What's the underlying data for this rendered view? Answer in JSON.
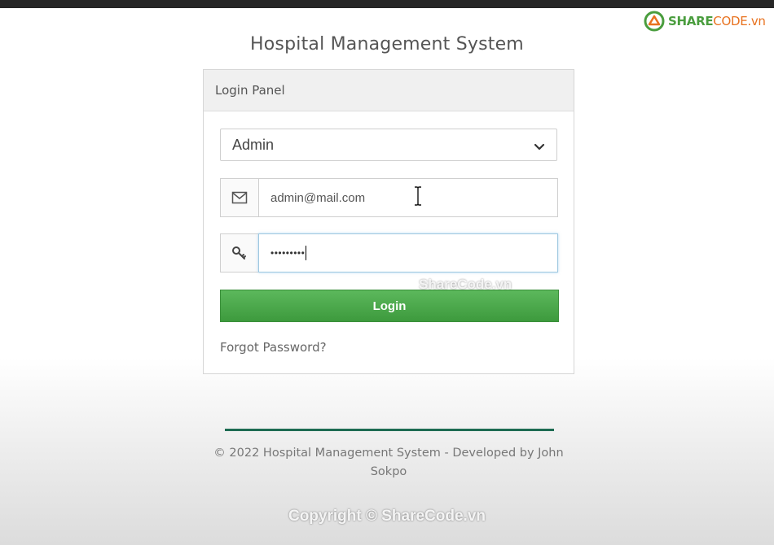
{
  "brand": {
    "part1": "SHARE",
    "part2": "CODE.vn",
    "icon": "sharecode-logo-icon"
  },
  "page": {
    "title": "Hospital Management System"
  },
  "login_panel": {
    "heading": "Login Panel",
    "role_select": {
      "value": "Admin",
      "icon": "chevron-down-icon"
    },
    "email": {
      "value": "admin@mail.com",
      "icon": "envelope-icon"
    },
    "password": {
      "masked_value": "•••••••••",
      "icon": "key-icon"
    },
    "login_button": "Login",
    "forgot_link": "Forgot Password?"
  },
  "footer": {
    "text": "© 2022 Hospital Management System - Developed by John Sokpo"
  },
  "watermarks": {
    "middle": "ShareCode.vn",
    "bottom": "Copyright © ShareCode.vn"
  },
  "colors": {
    "brand_green": "#4a9d3e",
    "brand_orange": "#e8711e",
    "button_green": "#4cae4c",
    "divider_green": "#1d6b52"
  }
}
